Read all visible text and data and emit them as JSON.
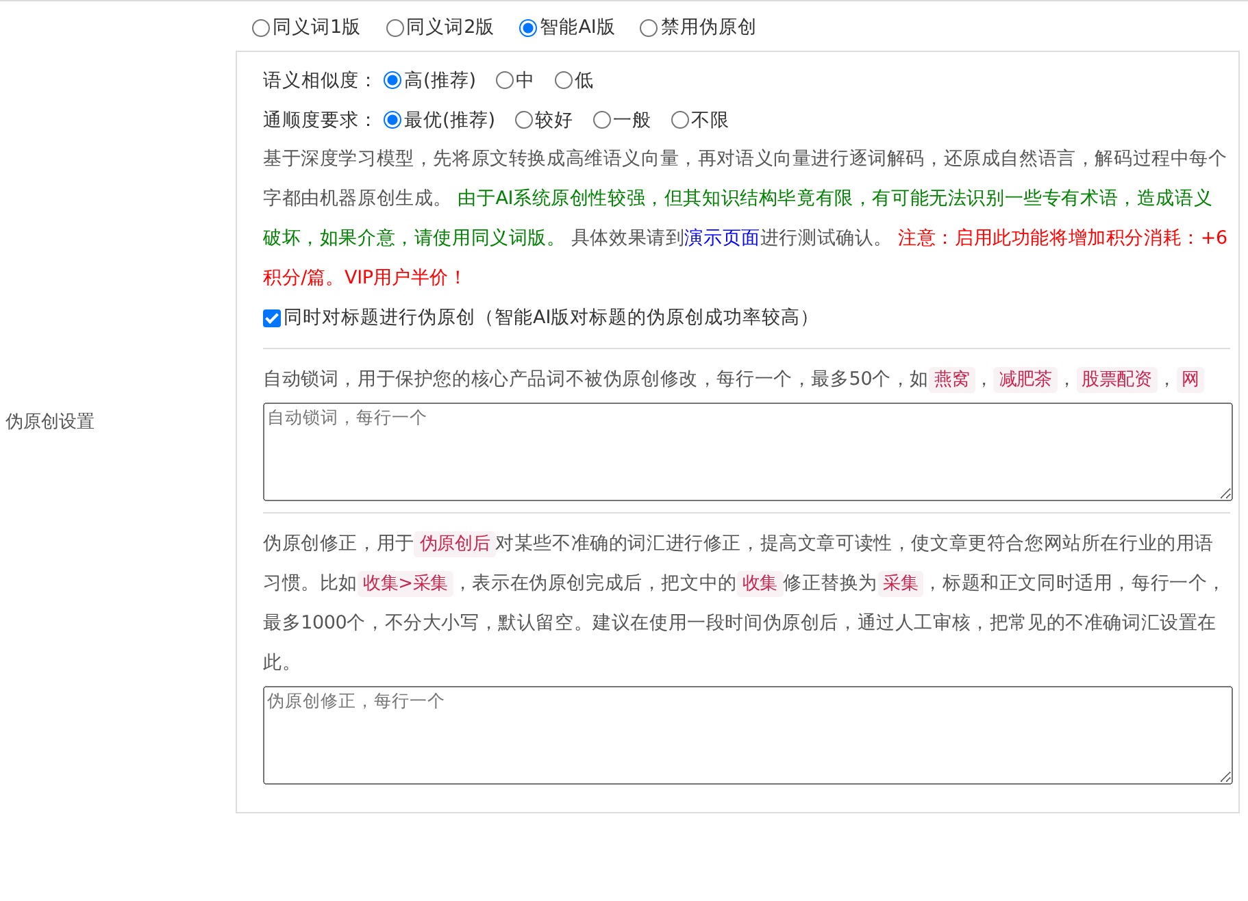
{
  "side_label": "伪原创设置",
  "mode_options": [
    {
      "label": "同义词1版",
      "selected": false
    },
    {
      "label": "同义词2版",
      "selected": false
    },
    {
      "label": "智能AI版",
      "selected": true
    },
    {
      "label": "禁用伪原创",
      "selected": false
    }
  ],
  "settings": [
    {
      "label": "语义相似度：",
      "options": [
        {
          "label": "高(推荐)",
          "selected": true
        },
        {
          "label": "中",
          "selected": false
        },
        {
          "label": "低",
          "selected": false
        }
      ]
    },
    {
      "label": "通顺度要求：",
      "options": [
        {
          "label": "最优(推荐)",
          "selected": true
        },
        {
          "label": "较好",
          "selected": false
        },
        {
          "label": "一般",
          "selected": false
        },
        {
          "label": "不限",
          "selected": false
        }
      ]
    }
  ],
  "description": [
    {
      "kind": "text",
      "text": "基于深度学习模型，先将原文转换成高维语义向量，再对语义向量进行逐词解码，还原成自然语言，解码过程中每个字都由机器原创生成。 "
    },
    {
      "kind": "green",
      "text": "由于AI系统原创性较强，但其知识结构毕竟有限，有可能无法识别一些专有术语，造成语义破坏，如果介意，请使用同义词版。"
    },
    {
      "kind": "text",
      "text": " 具体效果请到"
    },
    {
      "kind": "link",
      "text": "演示页面"
    },
    {
      "kind": "text",
      "text": "进行测试确认。 "
    },
    {
      "kind": "red",
      "text": "注意：启用此功能将增加积分消耗：+6积分/篇。VIP用户半价！"
    }
  ],
  "title_checkbox": {
    "label": "同时对标题进行伪原创（智能AI版对标题的伪原创成功率较高）",
    "checked": true
  },
  "lock_words": {
    "description": [
      {
        "kind": "text",
        "text": "自动锁词，用于保护您的核心产品词不被伪原创修改，每行一个，最多50个，如"
      },
      {
        "kind": "code",
        "text": "燕窝"
      },
      {
        "kind": "text",
        "text": "，"
      },
      {
        "kind": "code",
        "text": "减肥茶"
      },
      {
        "kind": "text",
        "text": "，"
      },
      {
        "kind": "code",
        "text": "股票配资"
      },
      {
        "kind": "text",
        "text": "，"
      },
      {
        "kind": "code",
        "text": "网"
      }
    ],
    "placeholder": "自动锁词，每行一个"
  },
  "correction": {
    "description": [
      {
        "kind": "text",
        "text": "伪原创修正，用于"
      },
      {
        "kind": "code",
        "text": "伪原创后"
      },
      {
        "kind": "text",
        "text": "对某些不准确的词汇进行修正，提高文章可读性，使文章更符合您网站所在行业的用语习惯。比如"
      },
      {
        "kind": "code",
        "text": "收集>采集"
      },
      {
        "kind": "text",
        "text": "，表示在伪原创完成后，把文中的"
      },
      {
        "kind": "code",
        "text": "收集"
      },
      {
        "kind": "text",
        "text": "修正替换为"
      },
      {
        "kind": "code",
        "text": "采集"
      },
      {
        "kind": "text",
        "text": "，标题和正文同时适用，每行一个，最多1000个，不分大小写，默认留空。建议在使用一段时间伪原创后，通过人工审核，把常见的不准确词汇设置在此。"
      }
    ],
    "placeholder": "伪原创修正，每行一个"
  }
}
